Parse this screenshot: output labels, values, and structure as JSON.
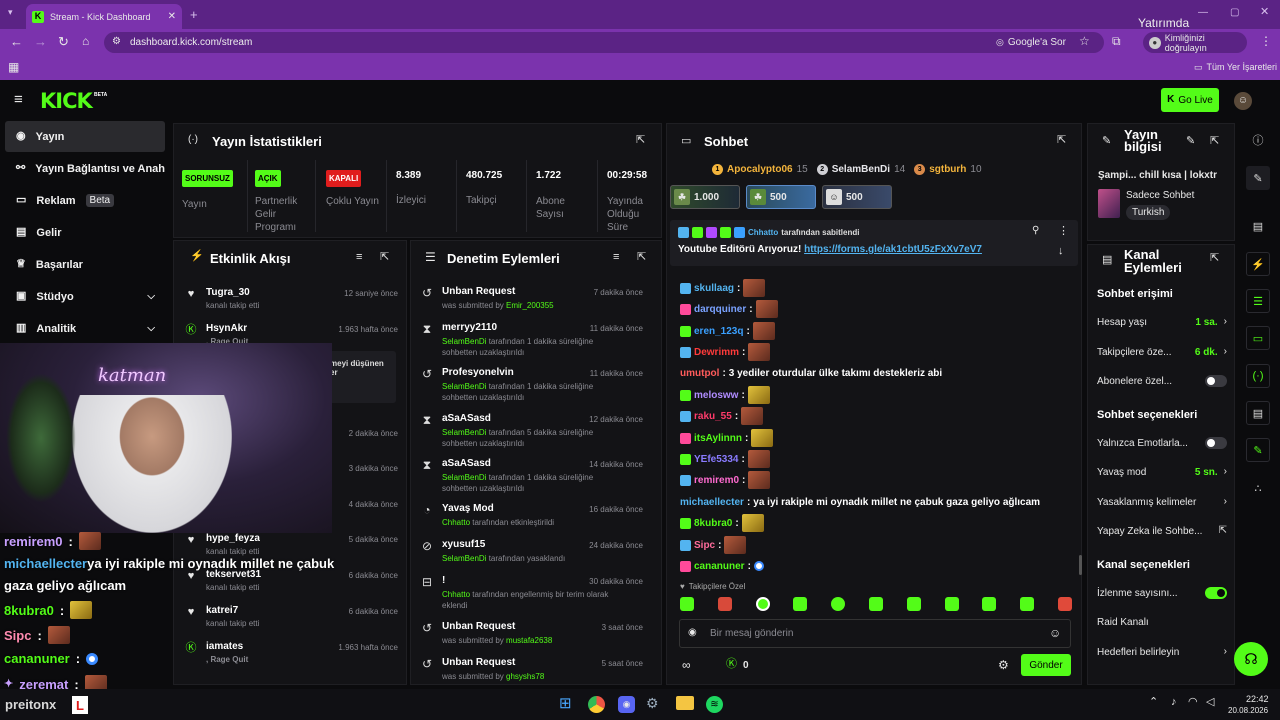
{
  "browser": {
    "tab_title": "Stream - Kick Dashboard",
    "url": "dashboard.kick.com/stream",
    "google_btn": "Google'a Sor",
    "identity_btn": "Kimliğinizi doğrulayın",
    "bookmarks_label": "Tüm Yer İşaretleri",
    "overlay_text": "Yatırımda"
  },
  "header": {
    "logo": "KICK",
    "beta": "BETA",
    "golive": "Go Live"
  },
  "sidebar": {
    "items": [
      {
        "label": "Yayın",
        "icon": "broadcast-icon"
      },
      {
        "label": "Yayın Bağlantısı ve Anahtar",
        "icon": "link-icon"
      },
      {
        "label": "Reklam",
        "badge": "Beta",
        "icon": "ad-icon"
      },
      {
        "label": "Gelir",
        "icon": "revenue-icon"
      },
      {
        "label": "Başarılar",
        "icon": "trophy-icon"
      },
      {
        "label": "Stüdyo",
        "icon": "studio-icon"
      },
      {
        "label": "Analitik",
        "icon": "analytics-icon"
      }
    ]
  },
  "stats": {
    "title": "Yayın İstatistikleri",
    "cells": [
      {
        "badge": "SORUNSUZ",
        "label": "Yayın"
      },
      {
        "badge": "AÇIK",
        "label": "Partnerlik Gelir Programı"
      },
      {
        "badge": "KAPALI",
        "label": "Çoklu Yayın"
      },
      {
        "value": "8.389",
        "label": "İzleyici"
      },
      {
        "value": "480.725",
        "label": "Takipçi"
      },
      {
        "value": "1.722",
        "label": "Abone Sayısı"
      },
      {
        "value": "00:29:58",
        "label": "Yayında Olduğu Süre"
      }
    ]
  },
  "events": {
    "title": "Etkinlik Akışı",
    "items": [
      {
        "name": "Tugra_30",
        "sub": "kanalı takip etti",
        "time": "12 saniye önce"
      },
      {
        "name": "HsynAkr",
        "sub": ", Rage Quit",
        "time": "1.963 hafta önce"
      },
      {
        "name": "",
        "sub": "",
        "time": "2 dakika önce"
      },
      {
        "name": "",
        "sub": "",
        "time": "3 dakika önce"
      },
      {
        "name": "",
        "sub": "",
        "time": "4 dakika önce"
      },
      {
        "name": "hype_feyza",
        "sub": "kanalı takip etti",
        "time": "5 dakika önce"
      },
      {
        "name": "tekservet31",
        "sub": "kanalı takip etti",
        "time": "6 dakika önce"
      },
      {
        "name": "katrei7",
        "sub": "kanalı takip etti",
        "time": "6 dakika önce"
      },
      {
        "name": "iamates",
        "sub": ", Rage Quit",
        "time": "1.963 hafta önce"
      }
    ],
    "quote_line1": "meyi düşünen",
    "quote_line2": "er"
  },
  "moderation": {
    "title": "Denetim Eylemleri",
    "items": [
      {
        "name": "Unban Request",
        "sub_pre": "was submitted by ",
        "actor": "Emir_200355",
        "sub_post": "",
        "time": "7 dakika önce"
      },
      {
        "name": "merryy2110",
        "sub_pre": "",
        "actor": "SelamBenDi",
        "sub_post": " tarafından 1 dakika süreliğine sohbetten uzaklaştırıldı",
        "time": "11 dakika önce"
      },
      {
        "name": "Profesyonelvin",
        "sub_pre": "",
        "actor": "SelamBenDi",
        "sub_post": " tarafından 1 dakika süreliğine sohbetten uzaklaştırıldı",
        "time": "11 dakika önce"
      },
      {
        "name": "aSaASasd",
        "sub_pre": "",
        "actor": "SelamBenDi",
        "sub_post": " tarafından 5 dakika süreliğine sohbetten uzaklaştırıldı",
        "time": "12 dakika önce"
      },
      {
        "name": "aSaASasd",
        "sub_pre": "",
        "actor": "SelamBenDi",
        "sub_post": " tarafından 1 dakika süreliğine sohbetten uzaklaştırıldı",
        "time": "14 dakika önce"
      },
      {
        "name": "Yavaş Mod",
        "sub_pre": "",
        "actor": "Chhatto",
        "sub_post": " tarafından etkinleştirildi",
        "time": "16 dakika önce"
      },
      {
        "name": "xyusuf15",
        "sub_pre": "",
        "actor": "SelamBenDi",
        "sub_post": " tarafından yasaklandı",
        "time": "24 dakika önce"
      },
      {
        "name": "!",
        "sub_pre": "",
        "actor": "Chhatto",
        "sub_post": " tarafından engellenmiş bir terim olarak eklendi",
        "time": "30 dakika önce"
      },
      {
        "name": "Unban Request",
        "sub_pre": "was submitted by ",
        "actor": "mustafa2638",
        "sub_post": "",
        "time": "3 saat önce"
      },
      {
        "name": "Unban Request",
        "sub_pre": "was submitted by ",
        "actor": "ghsyshs78",
        "sub_post": "",
        "time": "5 saat önce"
      }
    ]
  },
  "chat": {
    "title": "Sohbet",
    "leaders": [
      {
        "rank": "1",
        "name": "Apocalypto06",
        "count": "15",
        "color": "#f3b43c"
      },
      {
        "rank": "2",
        "name": "SelamBenDi",
        "count": "14",
        "color": "#cfcfd4"
      },
      {
        "rank": "3",
        "name": "sgtburh",
        "count": "10",
        "color": "#d98a4a"
      }
    ],
    "gifts": [
      "1.000",
      "500",
      "500"
    ],
    "pinned_by": "Chhatto",
    "pinned_label": "tarafından sabitlendi",
    "pinned_text": "Youtube Editörü Arıyoruz!",
    "pinned_link": "https://forms.gle/ak1cbtU5zFxXv7eV7",
    "messages": [
      {
        "user": "skullaag",
        "color": "#53b4f0",
        "text": "",
        "emote": "r"
      },
      {
        "user": "darqquiner",
        "color": "#7aa2ff",
        "text": "",
        "emote": "r"
      },
      {
        "user": "eren_123q",
        "color": "#3aa0ff",
        "text": "",
        "emote": "r"
      },
      {
        "user": "Dewrimm",
        "color": "#ff3b3b",
        "text": "",
        "emote": "r"
      },
      {
        "user": "umutpol",
        "color": "#ff5b5b",
        "text": " 3 yediler oturdular ülke takımı destekleriz abi",
        "emote": ""
      },
      {
        "user": "melosww",
        "color": "#b08cff",
        "text": "",
        "emote": "y"
      },
      {
        "user": "raku_55",
        "color": "#ff3b6b",
        "text": "",
        "emote": "r"
      },
      {
        "user": "itsAylinnn",
        "color": "#53fc18",
        "text": "",
        "emote": "y"
      },
      {
        "user": "YEfe5334",
        "color": "#8a7bff",
        "text": "",
        "emote": "r"
      },
      {
        "user": "remirem0",
        "color": "#ff6bd0",
        "text": "",
        "emote": "r"
      },
      {
        "user": "michaellecter",
        "color": "#53b4f0",
        "text": " ya iyi rakiple mi oynadık millet ne çabuk gaza geliyo ağlıcam",
        "emote": ""
      },
      {
        "user": "8kubra0",
        "color": "#53fc18",
        "text": "",
        "emote": "y"
      },
      {
        "user": "Sipc",
        "color": "#ff6b9b",
        "text": "",
        "emote": "r"
      },
      {
        "user": "cananuner",
        "color": "#53fc18",
        "text": "",
        "emote": "c"
      }
    ],
    "follow_label": "Takipçilere Özel",
    "input_placeholder": "Bir mesaj gönderin",
    "points": "0",
    "send": "Gönder"
  },
  "stream_info": {
    "title": "Yayın bilgisi",
    "stream_title": "Şampi... chill kısa | lokxtr",
    "category": "Sadece Sohbet",
    "tag": "Turkish"
  },
  "channel_actions": {
    "title": "Kanal Eylemleri",
    "chat_access": "Sohbet erişimi",
    "account_age": {
      "label": "Hesap yaşı",
      "value": "1 sa."
    },
    "follower_only": {
      "label": "Takipçilere öze...",
      "value": "6 dk."
    },
    "sub_only": {
      "label": "Abonelere özel...",
      "on": false
    },
    "chat_options": "Sohbet seçenekleri",
    "emote_only": {
      "label": "Yalnızca Emotlarla...",
      "on": false
    },
    "slow_mode": {
      "label": "Yavaş mod",
      "value": "5 sn."
    },
    "banned_words": "Yasaklanmış kelimeler",
    "ai_chat": "Yapay Zeka ile Sohbe...",
    "channel_options": "Kanal seçenekleri",
    "viewer_count": {
      "label": "İzlenme sayısını...",
      "on": true
    },
    "raid": "Raid Kanalı",
    "goals": "Hedefleri belirleyin"
  },
  "overlay": {
    "neon": "katman",
    "lines": [
      {
        "user": "remirem0",
        "color": "#c8a0ff",
        "text": "",
        "emote": "r"
      },
      {
        "user": "michaellecter",
        "color": "#53b4f0",
        "text": " ya iyi rakiple mi oynadık millet ne çabuk",
        "emote": ""
      },
      {
        "user": "",
        "color": "#fff",
        "text": "gaza geliyo ağlıcam",
        "emote": ""
      },
      {
        "user": "8kubra0",
        "color": "#53fc18",
        "text": "",
        "emote": "y"
      },
      {
        "user": "Sipc",
        "color": "#ff8bb0",
        "text": "",
        "emote": "r"
      },
      {
        "user": "cananuner",
        "color": "#53fc18",
        "text": "",
        "emote": "c"
      },
      {
        "user": "zeremat",
        "color": "#c8a0ff",
        "text": "",
        "emote": "r"
      },
      {
        "user": "preitonx",
        "color": "#c8c8c8",
        "text": "",
        "emote": "l"
      }
    ]
  },
  "taskbar": {
    "time": "22:42",
    "date": "20.08.2026"
  }
}
